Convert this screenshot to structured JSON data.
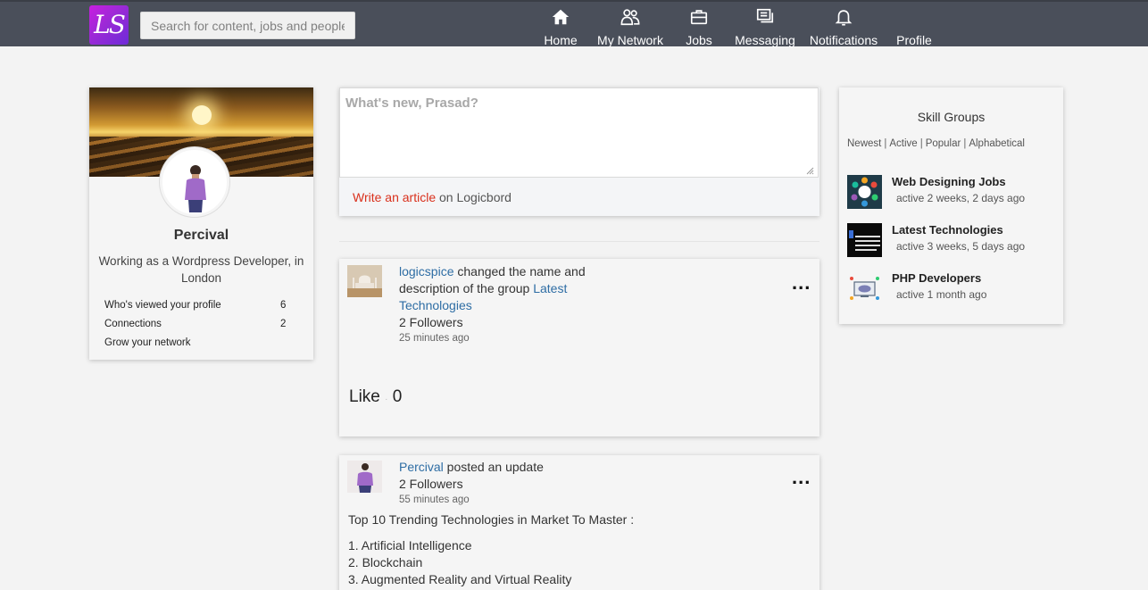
{
  "header": {
    "logo_text": "LS",
    "search_placeholder": "Search for content, jobs and people",
    "nav": [
      {
        "label": "Home",
        "icon": "home-icon"
      },
      {
        "label": "My Network",
        "icon": "network-icon"
      },
      {
        "label": "Jobs",
        "icon": "briefcase-icon"
      },
      {
        "label": "Messaging",
        "icon": "messaging-icon"
      },
      {
        "label": "Notifications",
        "icon": "bell-icon"
      },
      {
        "label": "Profile",
        "icon": ""
      }
    ]
  },
  "profile": {
    "name": "Percival",
    "description": "Working as a Wordpress Developer, in London",
    "stats": [
      {
        "label": "Who's viewed your profile",
        "value": "6"
      },
      {
        "label": "Connections",
        "value": "2"
      },
      {
        "label": "Grow your network",
        "value": ""
      }
    ]
  },
  "composer": {
    "placeholder": "What's new, Prasad?",
    "write_link": "Write an article",
    "write_suffix": " on Logicbord"
  },
  "feed": [
    {
      "author": "logicspice",
      "action": " changed the name and description of the group ",
      "group_link": "Latest Technologies",
      "followers": "2 Followers",
      "time": "25 minutes ago",
      "like_label": "Like",
      "like_count": "0",
      "more": "..."
    },
    {
      "author": "Percival",
      "action": " posted an update",
      "followers": "2 Followers",
      "time": "55 minutes ago",
      "body_title": "Top 10 Trending Technologies in Market To Master :",
      "list": [
        "1. Artificial Intelligence",
        "2. Blockchain",
        "3. Augmented Reality and Virtual Reality"
      ],
      "more": "..."
    }
  ],
  "skill_groups": {
    "title": "Skill Groups",
    "filters": [
      "Newest",
      "Active",
      "Popular",
      "Alphabetical"
    ],
    "items": [
      {
        "name": "Web Designing Jobs",
        "active": "active 2 weeks, 2 days ago"
      },
      {
        "name": "Latest Technologies",
        "active": "active 3 weeks, 5 days ago"
      },
      {
        "name": "PHP Developers",
        "active": "active 1 month ago"
      }
    ]
  },
  "colors": {
    "topbar": "#4a4f5a",
    "link_blue": "#2e6da4",
    "link_red": "#d9301c",
    "background": "#f3f3f3"
  }
}
